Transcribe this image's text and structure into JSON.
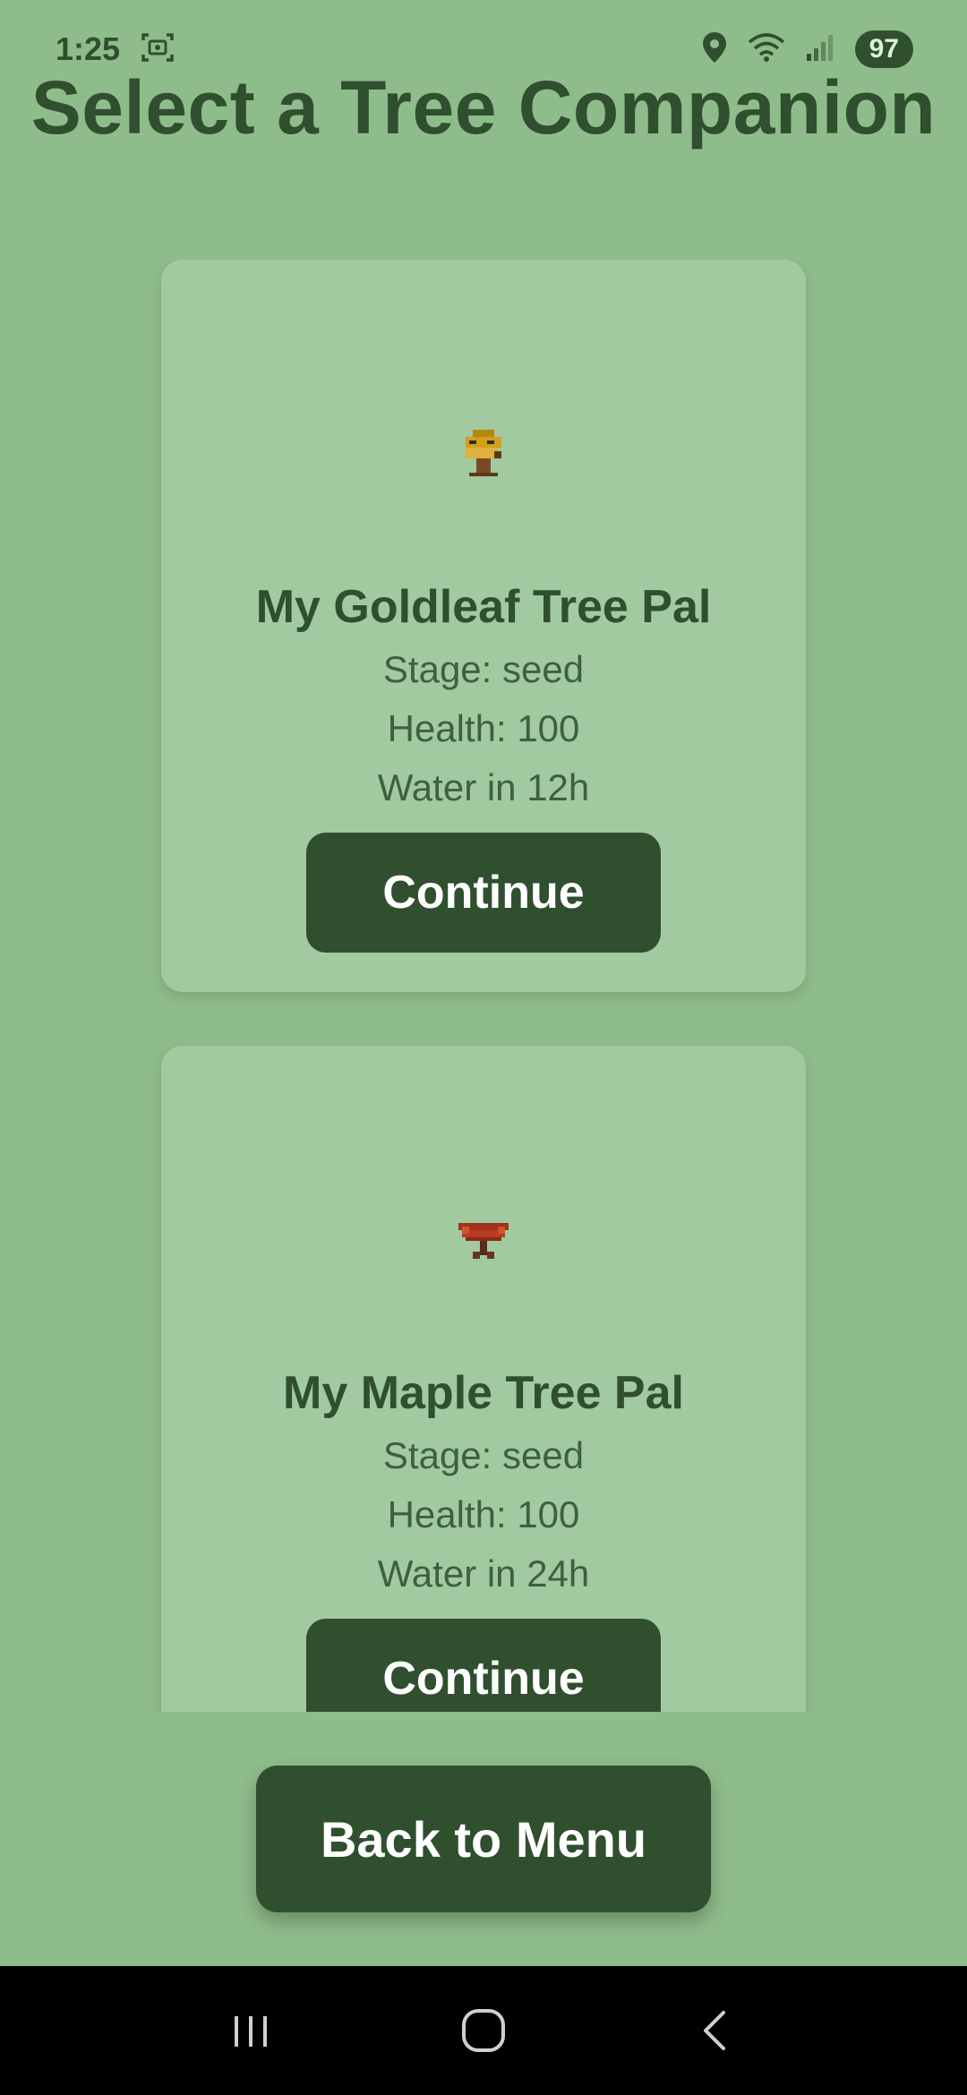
{
  "status_bar": {
    "time": "1:25",
    "battery": "97",
    "icons": [
      "screenshot-icon",
      "location-icon",
      "wifi-icon",
      "signal-icon"
    ]
  },
  "page": {
    "title": "Select a Tree Companion"
  },
  "trees": [
    {
      "name": "My Goldleaf Tree Pal",
      "stage": "Stage: seed",
      "health": "Health: 100",
      "water": "Water in 12h",
      "button_label": "Continue",
      "sprite": "goldleaf-sapling-sprite",
      "sprite_color": "#d4a017"
    },
    {
      "name": "My Maple Tree Pal",
      "stage": "Stage: seed",
      "health": "Health: 100",
      "water": "Water in 24h",
      "button_label": "Continue",
      "sprite": "maple-sapling-sprite",
      "sprite_color": "#b83a24"
    }
  ],
  "footer": {
    "back_label": "Back to Menu"
  },
  "nav_bar": {
    "icons": [
      "recent-apps-icon",
      "home-icon",
      "back-icon"
    ]
  },
  "colors": {
    "background": "#8fbc8b",
    "card": "#a2caa0",
    "accent": "#2f4f2f",
    "button_text": "#ffffff"
  }
}
